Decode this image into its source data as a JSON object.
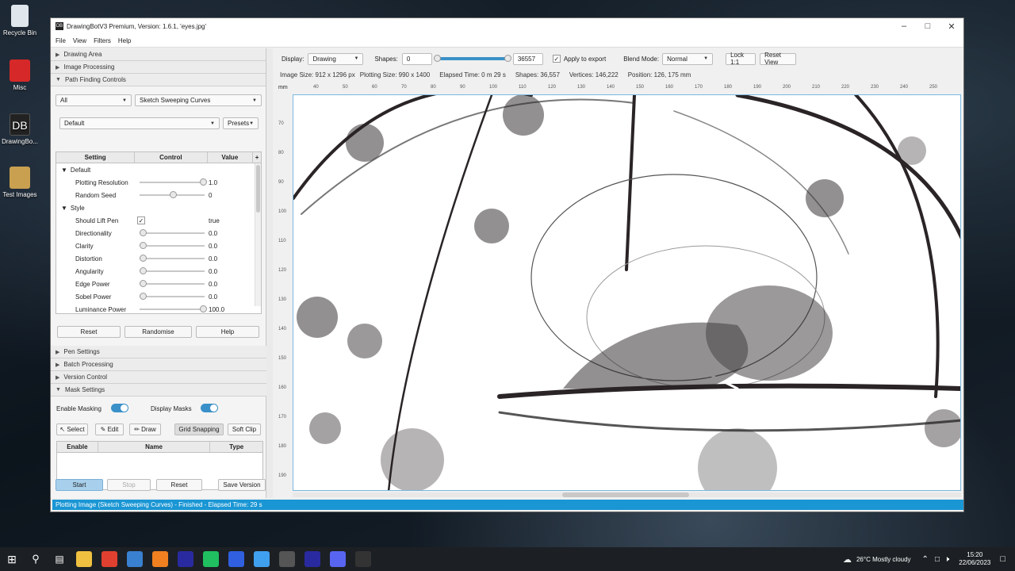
{
  "desktop": {
    "icons": [
      {
        "label": "Recycle Bin",
        "color": "#dfe6ec"
      },
      {
        "label": "Misc",
        "color": "#d62828"
      },
      {
        "label": "DrawingBo...",
        "color": "#222222"
      },
      {
        "label": "Test Images",
        "color": "#c8a050"
      }
    ]
  },
  "window": {
    "title": "DrawingBotV3 Premium, Version: 1.6.1, 'eyes.jpg'",
    "app_icon": "DB",
    "menu": [
      "File",
      "View",
      "Filters",
      "Help"
    ]
  },
  "left": {
    "sections_top": [
      "Drawing Area",
      "Image Processing",
      "Path Finding Controls"
    ],
    "filter_all": "All",
    "pfm": "Sketch Sweeping Curves",
    "preset": "Default",
    "presets_btn": "Presets",
    "table_headers": [
      "Setting",
      "Control",
      "Value"
    ],
    "groups": {
      "default": "Default",
      "style": "Style"
    },
    "settings": [
      {
        "label": "Plotting Resolution",
        "value": "1.0",
        "pos": 1.0
      },
      {
        "label": "Random Seed",
        "value": "0",
        "pos": 0.5
      }
    ],
    "style_settings": [
      {
        "label": "Should Lift Pen",
        "value": "true",
        "check": true
      },
      {
        "label": "Directionality",
        "value": "0.0",
        "pos": 0
      },
      {
        "label": "Clarity",
        "value": "0.0",
        "pos": 0
      },
      {
        "label": "Distortion",
        "value": "0.0",
        "pos": 0
      },
      {
        "label": "Angularity",
        "value": "0.0",
        "pos": 0
      },
      {
        "label": "Edge Power",
        "value": "0.0",
        "pos": 0
      },
      {
        "label": "Sobel Power",
        "value": "0.0",
        "pos": 0
      },
      {
        "label": "Luminance Power",
        "value": "100.0",
        "pos": 1.0
      }
    ],
    "buttons": {
      "reset": "Reset",
      "randomise": "Randomise",
      "help": "Help"
    },
    "sections_bottom": [
      "Pen Settings",
      "Batch Processing",
      "Version Control",
      "Mask Settings"
    ],
    "mask": {
      "enable_label": "Enable Masking",
      "display_label": "Display Masks",
      "tools": [
        "Select",
        "Edit",
        "Draw",
        "Grid Snapping",
        "Soft Clip"
      ],
      "headers": [
        "Enable",
        "Name",
        "Type"
      ]
    },
    "bottom_buttons": {
      "start": "Start",
      "stop": "Stop",
      "reset": "Reset",
      "save": "Save Version"
    }
  },
  "toolbar": {
    "display_label": "Display:",
    "display_value": "Drawing",
    "shapes_label": "Shapes:",
    "shapes_min": "0",
    "shapes_max": "36557",
    "apply_export": "Apply to export",
    "blend_label": "Blend Mode:",
    "blend_value": "Normal",
    "lock": "Lock 1:1",
    "reset_view": "Reset View"
  },
  "info": {
    "image_size": "Image Size: 912 x 1296 px",
    "plotting_size": "Plotting Size: 990 x 1400",
    "elapsed": "Elapsed Time: 0 m 29 s",
    "shapes": "Shapes: 36,557",
    "vertices": "Vertices: 146,222",
    "position": "Position: 126, 175 mm"
  },
  "ruler": {
    "unit": "mm",
    "h_ticks": [
      "40",
      "50",
      "60",
      "70",
      "80",
      "90",
      "100",
      "110",
      "120",
      "130",
      "140",
      "150",
      "160",
      "170",
      "180",
      "190",
      "200",
      "210",
      "220",
      "230",
      "240",
      "250"
    ],
    "v_ticks": [
      "70",
      "80",
      "90",
      "100",
      "110",
      "120",
      "130",
      "140",
      "150",
      "160",
      "170",
      "180",
      "190"
    ]
  },
  "status": "Plotting Image (Sketch Sweeping Curves) - Finished - Elapsed Time: 29 s",
  "taskbar": {
    "weather": "26°C  Mostly cloudy",
    "time": "15:20",
    "date": "22/06/2023",
    "apps": [
      "#f0c040",
      "#e04030",
      "#3a80d0",
      "#f08020",
      "#2a2aa0",
      "#20c060",
      "#3060e0",
      "#40a0f0",
      "#555555",
      "#2a2aa0",
      "#5865f2",
      "#333333"
    ]
  }
}
